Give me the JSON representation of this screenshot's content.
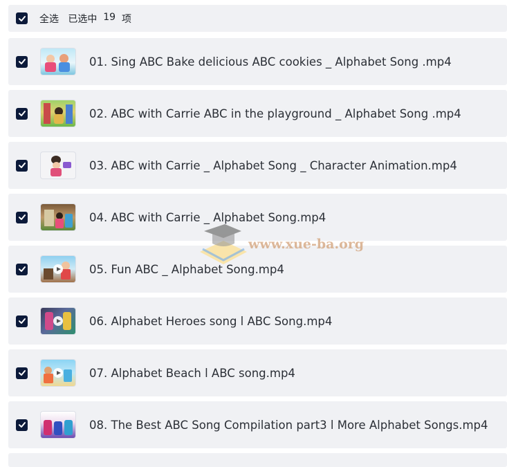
{
  "header": {
    "select_all_label": "全选",
    "selected_prefix": "已选中",
    "selected_count": "19",
    "selected_suffix": "项"
  },
  "files": [
    {
      "name": "01. Sing ABC Bake delicious ABC cookies _ Alphabet Song .mp4"
    },
    {
      "name": "02. ABC with Carrie ABC in the playground _ Alphabet Song .mp4"
    },
    {
      "name": "03. ABC with Carrie _ Alphabet Song _ Character Animation.mp4"
    },
    {
      "name": "04. ABC with Carrie _ Alphabet Song.mp4"
    },
    {
      "name": "05. Fun ABC _ Alphabet Song.mp4"
    },
    {
      "name": "06. Alphabet Heroes song l ABC Song.mp4"
    },
    {
      "name": "07. Alphabet Beach l ABC song.mp4"
    },
    {
      "name": "08. The Best ABC Song Compilation part3 l More Alphabet Songs.mp4"
    }
  ],
  "watermark": {
    "text": "www.xue-ba.org"
  },
  "colors": {
    "checkbox": "#0c1a3a",
    "row_bg": "#f0f1f4"
  },
  "icons": {
    "checkbox": "checkmark-icon",
    "thumbnail": "video-thumbnail",
    "play": "play-icon"
  }
}
